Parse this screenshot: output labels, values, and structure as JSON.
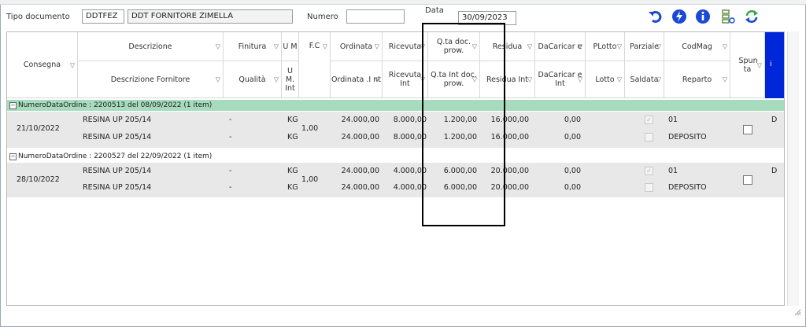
{
  "toolbar": {
    "tipo_label": "Tipo documento",
    "tipo_code": "DDTFEZ",
    "tipo_desc": "DDT FORNITORE ZIMELLA",
    "numero_label": "Numero",
    "numero_value": "",
    "data_label": "Data",
    "data_value": "30/09/2023",
    "icons": [
      "undo-icon",
      "flash-icon",
      "info-icon",
      "checklist-icon",
      "refresh-icon"
    ]
  },
  "columns": {
    "consegna": "Consegna",
    "descrizione": "Descrizione",
    "descrizione_fornitore": "Descrizione Fornitore",
    "finitura": "Finitura",
    "qualita": "Qualità",
    "um": "U M",
    "um_int": "U M. Int",
    "fc": "F.C",
    "ordinata": "Ordinata",
    "ordinata_int": "Ordinata .I nt",
    "ricevuta": "Ricevuta",
    "ricevuta_int": "Ricevuta Int",
    "qta_doc": "Q.ta doc. prow.",
    "qta_int": "Q.ta Int doc. prow.",
    "residua": "Residua",
    "residua_int": "Residua Int",
    "dacaricare": "DaCaricar e",
    "dacaricare_int": "DaCaricar e Int",
    "plotto": "PLotto",
    "lotto": "Lotto",
    "parziale": "Parziale",
    "saldata": "Saldata",
    "codmag": "CodMag",
    "reparto": "Reparto",
    "spunta": "Spun ta",
    "i": "i"
  },
  "groups": [
    {
      "label": "NumeroDataOrdine : 2200513 del 08/09/2022 (1 item)",
      "highlight": true,
      "consegna": "21/10/2022",
      "descrizione": "RESINA UP 205/14",
      "descrizione_fornitore": "RESINA UP 205/14",
      "finitura": "-",
      "qualita": "-",
      "um": "KG",
      "um_int": "KG",
      "fc": "1,00",
      "ordinata": "24.000,00",
      "ordinata_int": "24.000,00",
      "ricevuta": "8.000,00",
      "ricevuta_int": "8.000,00",
      "qta_doc": "1.200,00",
      "qta_int": "1.200,00",
      "residua": "16.000,00",
      "residua_int": "16.000,00",
      "dacaricare": "0,00",
      "dacaricare_int": "0,00",
      "codmag": "01",
      "reparto": "DEPOSITO",
      "i": "D"
    },
    {
      "label": "NumeroDataOrdine : 2200527 del 22/09/2022 (1 item)",
      "highlight": false,
      "consegna": "28/10/2022",
      "descrizione": "RESINA UP 205/14",
      "descrizione_fornitore": "RESINA UP 205/14",
      "finitura": "-",
      "qualita": "-",
      "um": "KG",
      "um_int": "KG",
      "fc": "1,00",
      "ordinata": "24.000,00",
      "ordinata_int": "24.000,00",
      "ricevuta": "4.000,00",
      "ricevuta_int": "4.000,00",
      "qta_doc": "6.000,00",
      "qta_int": "6.000,00",
      "residua": "20.000,00",
      "residua_int": "20.000,00",
      "dacaricare": "0,00",
      "dacaricare_int": "0,00",
      "codmag": "01",
      "reparto": "DEPOSITO",
      "i": "D"
    }
  ],
  "colors": {
    "group_highlight": "#a6dcbd",
    "row_bg": "#e8e8e8",
    "accent_blue": "#0026d9"
  }
}
